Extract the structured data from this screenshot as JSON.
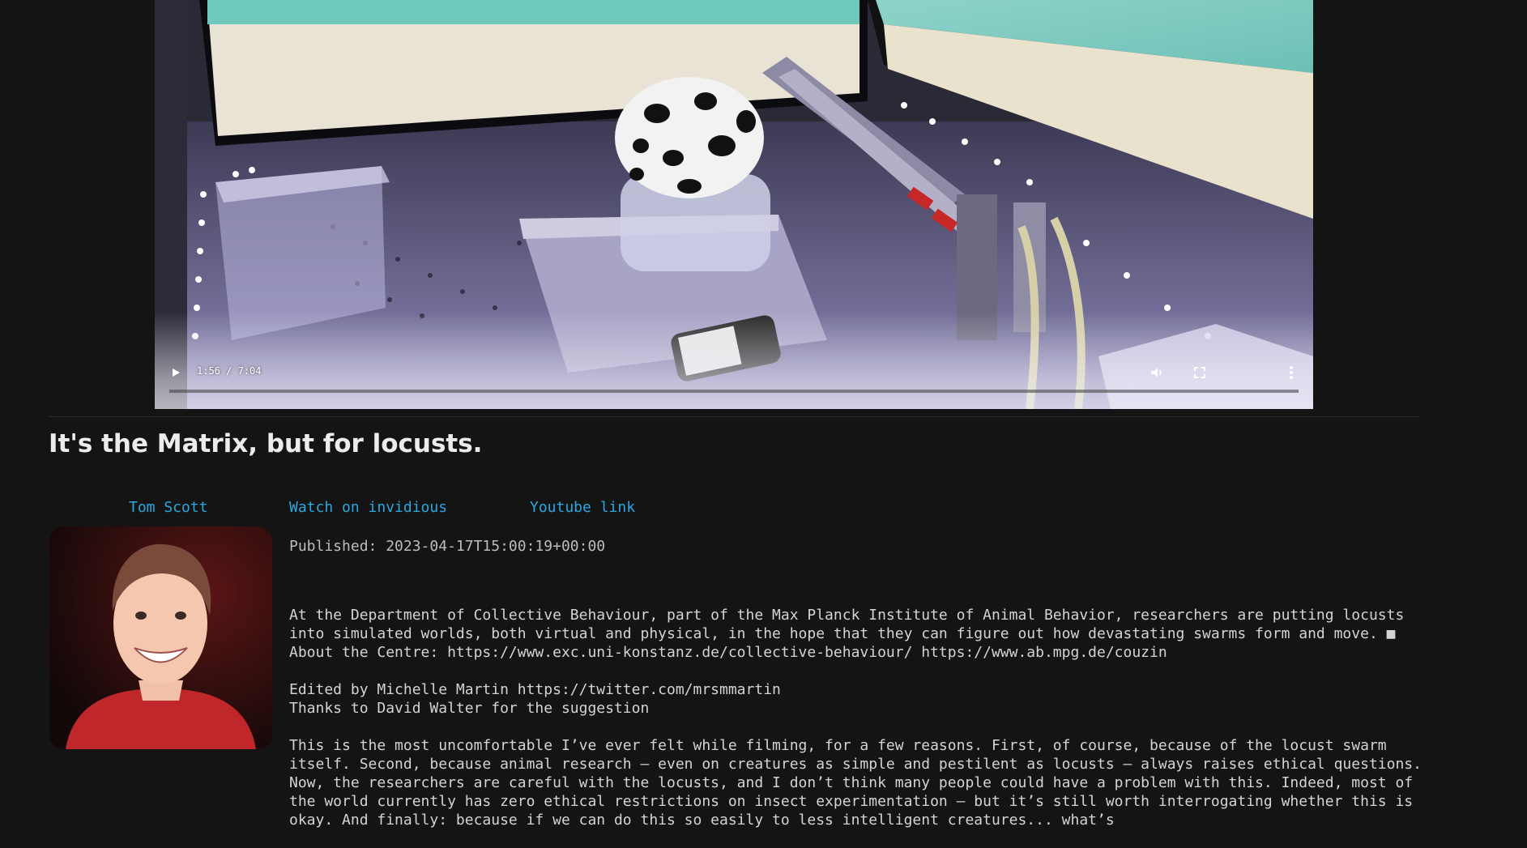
{
  "video": {
    "time_display": "1:56 / 7:04",
    "progress_fraction": 0.0,
    "icons": {
      "play": "play-icon",
      "volume": "volume-icon",
      "fullscreen": "fullscreen-icon",
      "more": "more-options-icon"
    }
  },
  "page": {
    "title": "It's the Matrix, but for locusts."
  },
  "links": {
    "channel": "Tom Scott",
    "invidious": "Watch on invidious",
    "youtube": "Youtube link"
  },
  "meta": {
    "published": "Published: 2023-04-17T15:00:19+00:00"
  },
  "description": {
    "paragraph_1": "At the Department of Collective Behaviour, part of the Max Planck Institute of Animal Behavior, researchers are putting locusts into simulated worlds, both virtual and physical, in the hope that they can figure out how devastating swarms form and move. ■ About the Centre: https://www.exc.uni-konstanz.de/collective-behaviour/ https://www.ab.mpg.de/couzin",
    "paragraph_2": "Edited by Michelle Martin https://twitter.com/mrsmmartin\nThanks to David Walter for the suggestion",
    "paragraph_3": "This is the most uncomfortable I’ve ever felt while filming, for a few reasons. First, of course, because of the locust swarm itself. Second, because animal research — even on creatures as simple and pestilent as locusts — always raises ethical questions. Now, the researchers are careful with the locusts, and I don’t think many people could have a problem with this. Indeed, most of the world currently has zero ethical restrictions on insect experimentation — but it’s still worth interrogating whether this is okay. And finally: because if we can do this so easily to less intelligent creatures... what’s"
  },
  "colors": {
    "background": "#141414",
    "link": "#2aa8e0",
    "text": "#d4d4d4"
  }
}
